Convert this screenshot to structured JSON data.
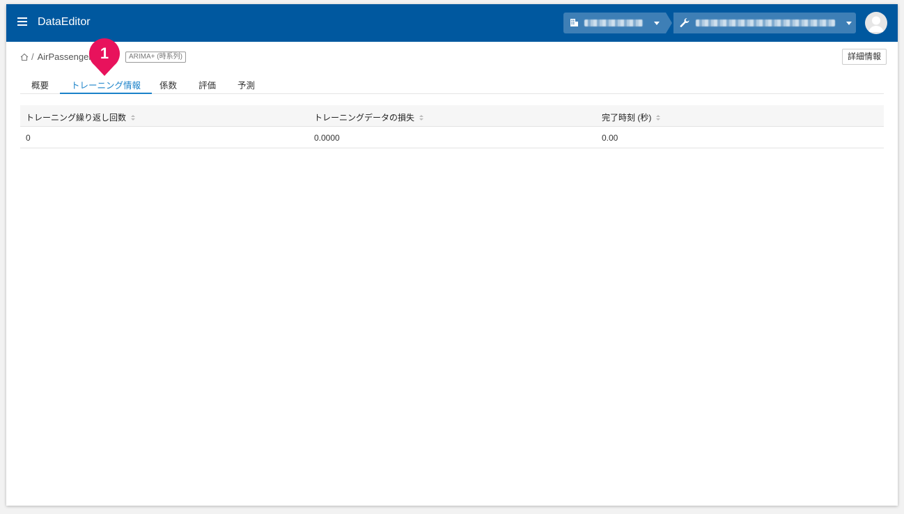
{
  "app": {
    "title": "DataEditor"
  },
  "breadcrumb": {
    "separator": "/",
    "current": "AirPassenger",
    "model_tag": "ARIMA+ (時系列)"
  },
  "actions": {
    "detail_label": "詳細情報"
  },
  "tabs": [
    {
      "label": "概要",
      "active": false
    },
    {
      "label": "トレーニング情報",
      "active": true
    },
    {
      "label": "係数",
      "active": false
    },
    {
      "label": "評価",
      "active": false
    },
    {
      "label": "予測",
      "active": false
    }
  ],
  "table": {
    "headers": [
      "トレーニング繰り返し回数",
      "トレーニングデータの損失",
      "完了時刻 (秒)"
    ],
    "rows": [
      [
        "0",
        "0.0000",
        "0.00"
      ]
    ]
  },
  "annotation": {
    "number": "1",
    "color": "#e8125c"
  },
  "colors": {
    "appbar": "#00589f",
    "accent": "#1b82c9"
  },
  "icons": [
    "menu-icon",
    "building-icon",
    "wrench-icon",
    "home-icon",
    "user-avatar-icon",
    "sort-icon"
  ]
}
